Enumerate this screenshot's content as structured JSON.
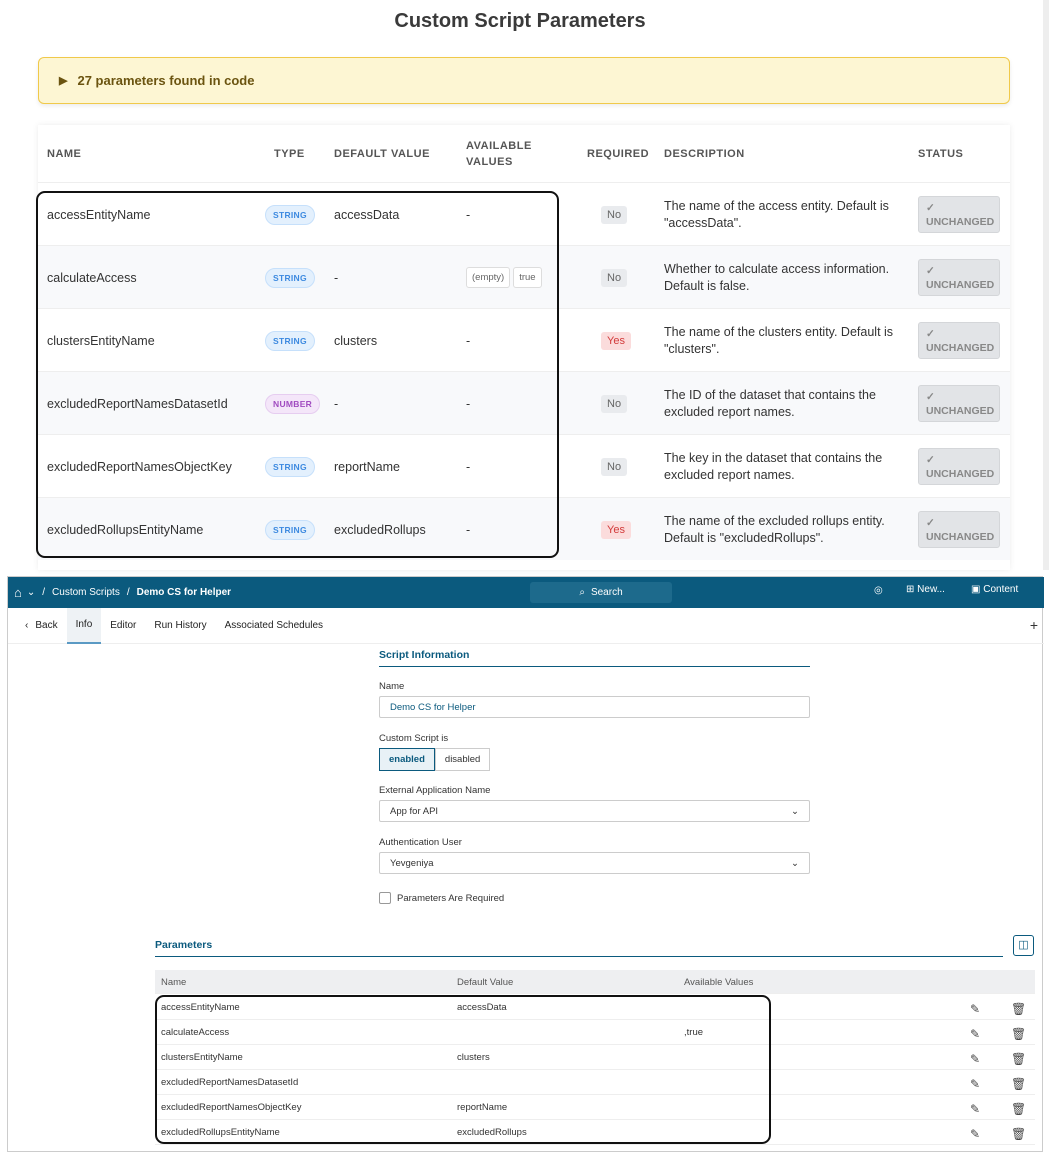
{
  "top": {
    "title": "Custom Script Parameters",
    "banner": "27 parameters found in code",
    "columns": [
      "NAME",
      "TYPE",
      "DEFAULT VALUE",
      "AVAILABLE VALUES",
      "REQUIRED",
      "DESCRIPTION",
      "STATUS"
    ],
    "status_label": "UNCHANGED",
    "rows": [
      {
        "name": "accessEntityName",
        "type": "STRING",
        "default": "accessData",
        "available": "-",
        "required": "No",
        "description": "The name of the access entity. Default is \"accessData\"."
      },
      {
        "name": "calculateAccess",
        "type": "STRING",
        "default": "-",
        "available_chips": [
          "(empty)",
          "true"
        ],
        "required": "No",
        "description": "Whether to calculate access information. Default is false."
      },
      {
        "name": "clustersEntityName",
        "type": "STRING",
        "default": "clusters",
        "available": "-",
        "required": "Yes",
        "description": "The name of the clusters entity. Default is \"clusters\"."
      },
      {
        "name": "excludedReportNamesDatasetId",
        "type": "NUMBER",
        "default": "-",
        "available": "-",
        "required": "No",
        "description": "The ID of the dataset that contains the excluded report names."
      },
      {
        "name": "excludedReportNamesObjectKey",
        "type": "STRING",
        "default": "reportName",
        "available": "-",
        "required": "No",
        "description": "The key in the dataset that contains the excluded report names."
      },
      {
        "name": "excludedRollupsEntityName",
        "type": "STRING",
        "default": "excludedRollups",
        "available": "-",
        "required": "Yes",
        "description": "The name of the excluded rollups entity. Default is \"excludedRollups\"."
      }
    ]
  },
  "nav": {
    "breadcrumb": [
      "Custom Scripts",
      "Demo CS for Helper"
    ],
    "search": "Search",
    "new": "New...",
    "content": "Content"
  },
  "tabs": {
    "back": "Back",
    "items": [
      "Info",
      "Editor",
      "Run History",
      "Associated Schedules"
    ]
  },
  "form": {
    "section": "Script Information",
    "name_label": "Name",
    "name_value": "Demo CS for Helper",
    "enabled_label": "Custom Script is",
    "enabled": "enabled",
    "disabled": "disabled",
    "ext_label": "External Application Name",
    "ext_value": "App for API",
    "auth_label": "Authentication User",
    "auth_value": "Yevgeniya",
    "params_required": "Parameters Are Required"
  },
  "params": {
    "title": "Parameters",
    "columns": [
      "Name",
      "Default Value",
      "Available Values"
    ],
    "rows": [
      {
        "name": "accessEntityName",
        "default": "accessData",
        "available": ""
      },
      {
        "name": "calculateAccess",
        "default": "",
        "available": ",true"
      },
      {
        "name": "clustersEntityName",
        "default": "clusters",
        "available": ""
      },
      {
        "name": "excludedReportNamesDatasetId",
        "default": "",
        "available": ""
      },
      {
        "name": "excludedReportNamesObjectKey",
        "default": "reportName",
        "available": ""
      },
      {
        "name": "excludedRollupsEntityName",
        "default": "excludedRollups",
        "available": ""
      }
    ]
  }
}
